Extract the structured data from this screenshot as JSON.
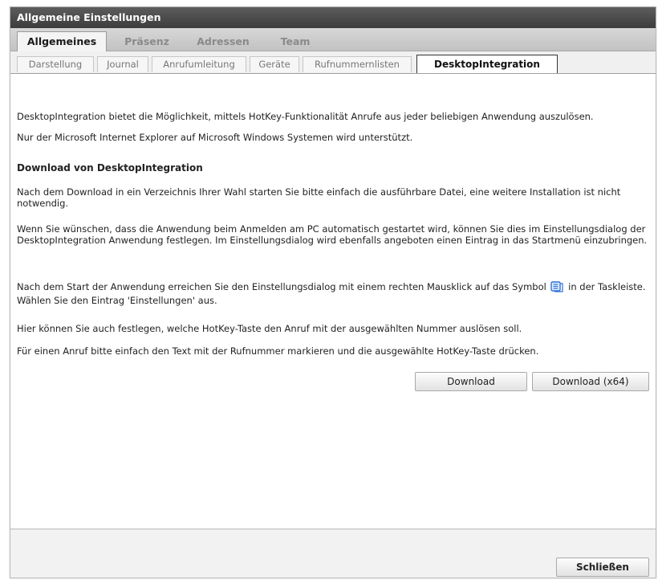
{
  "window": {
    "title": "Allgemeine Einstellungen"
  },
  "main_tabs": [
    {
      "label": "Allgemeines",
      "active": true
    },
    {
      "label": "Präsenz",
      "active": false
    },
    {
      "label": "Adressen",
      "active": false
    },
    {
      "label": "Team",
      "active": false
    }
  ],
  "sub_tabs": [
    {
      "label": "Darstellung",
      "active": false
    },
    {
      "label": "Journal",
      "active": false
    },
    {
      "label": "Anrufumleitung",
      "active": false
    },
    {
      "label": "Geräte",
      "active": false
    },
    {
      "label": "Rufnummernlisten",
      "active": false
    },
    {
      "label": "DesktopIntegration",
      "active": true
    }
  ],
  "content": {
    "intro1": "DesktopIntegration bietet die Möglichkeit, mittels HotKey-Funktionalität Anrufe aus jeder beliebigen Anwendung auszulösen.",
    "intro2": "Nur der Microsoft Internet Explorer auf Microsoft Windows Systemen wird unterstützt.",
    "heading": "Download von DesktopIntegration",
    "para1": "Nach dem Download in ein Verzeichnis Ihrer Wahl starten Sie bitte einfach die ausführbare Datei, eine weitere Installation ist nicht notwendig.",
    "para2": "Wenn Sie wünschen, dass die Anwendung beim Anmelden am PC automatisch gestartet wird, können Sie dies im Einstellungsdialog der DesktopIntegration Anwendung festlegen. Im Einstellungsdialog wird ebenfalls angeboten einen Eintrag in das Startmenü einzubringen.",
    "para3_before_icon": "Nach dem Start der Anwendung erreichen Sie den Einstellungsdialog mit einem rechten Mausklick auf das Symbol",
    "para3_after_icon": "in der Taskleiste. Wählen Sie den Eintrag 'Einstellungen' aus.",
    "para4": "Hier können Sie auch festlegen, welche HotKey-Taste den Anruf mit der ausgewählten Nummer auslösen soll.",
    "para5": "Für einen Anruf bitte einfach den Text mit der Rufnummer markieren und die ausgewählte HotKey-Taste drücken.",
    "tray_icon": "desktop-integration-tray-icon"
  },
  "buttons": {
    "download": "Download",
    "download_x64": "Download (x64)",
    "close": "Schließen"
  },
  "colors": {
    "titlebar": "#4a4a4a",
    "tray_icon": "#2f6fd6"
  }
}
